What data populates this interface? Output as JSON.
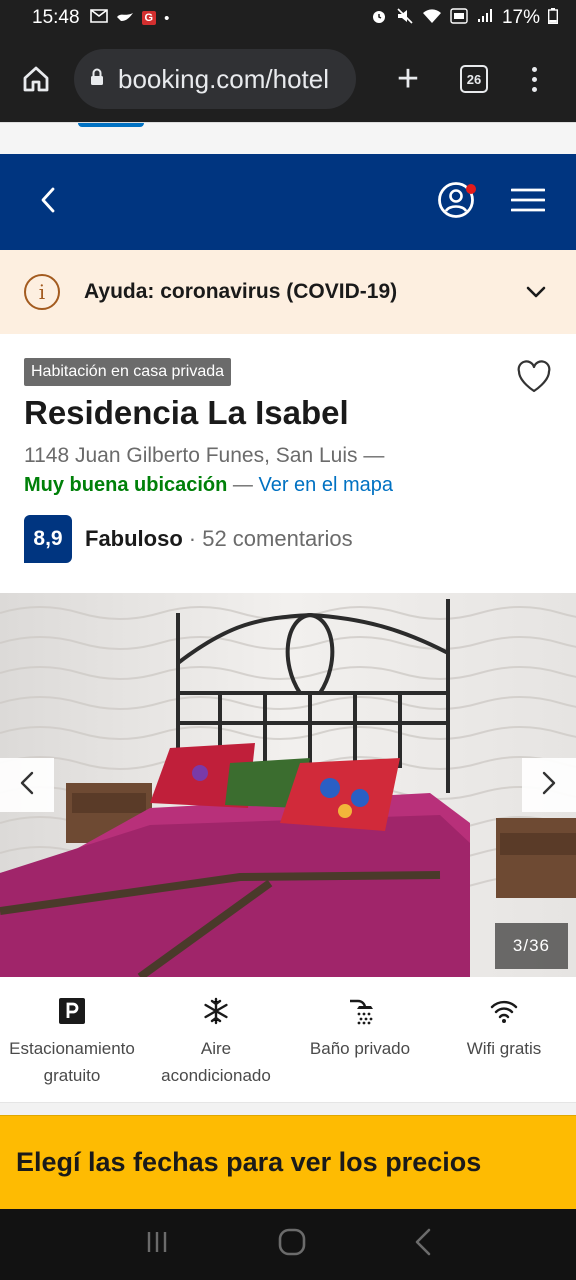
{
  "status_bar": {
    "time": "15:48",
    "notif_badge": "G",
    "battery": "17%"
  },
  "browser": {
    "url": "booking.com/hotel",
    "tab_count": "26"
  },
  "covid_banner": {
    "text": "Ayuda: coronavirus (COVID-19)"
  },
  "property": {
    "type_badge": "Habitación en casa privada",
    "name": "Residencia La Isabel",
    "address": "1148 Juan Gilberto Funes, San Luis —",
    "location_rating": "Muy buena ubicación",
    "location_sep": " — ",
    "map_link": "Ver en el mapa",
    "score": "8,9",
    "score_word": "Fabuloso",
    "reviews": "· 52 comentarios"
  },
  "gallery": {
    "counter": "3/36"
  },
  "facilities": [
    {
      "icon": "parking-icon",
      "label": "Estacionamiento gratuito"
    },
    {
      "icon": "snowflake-icon",
      "label": "Aire acondicionado"
    },
    {
      "icon": "shower-icon",
      "label": "Baño privado"
    },
    {
      "icon": "wifi-icon",
      "label": "Wifi gratis"
    }
  ],
  "cta": {
    "text": "Elegí las fechas para ver los precios"
  },
  "colors": {
    "brand_blue": "#003580",
    "link_blue": "#0071c2",
    "cta_yellow": "#febb02",
    "good_green": "#008009",
    "covid_bg": "#fdefe0"
  }
}
